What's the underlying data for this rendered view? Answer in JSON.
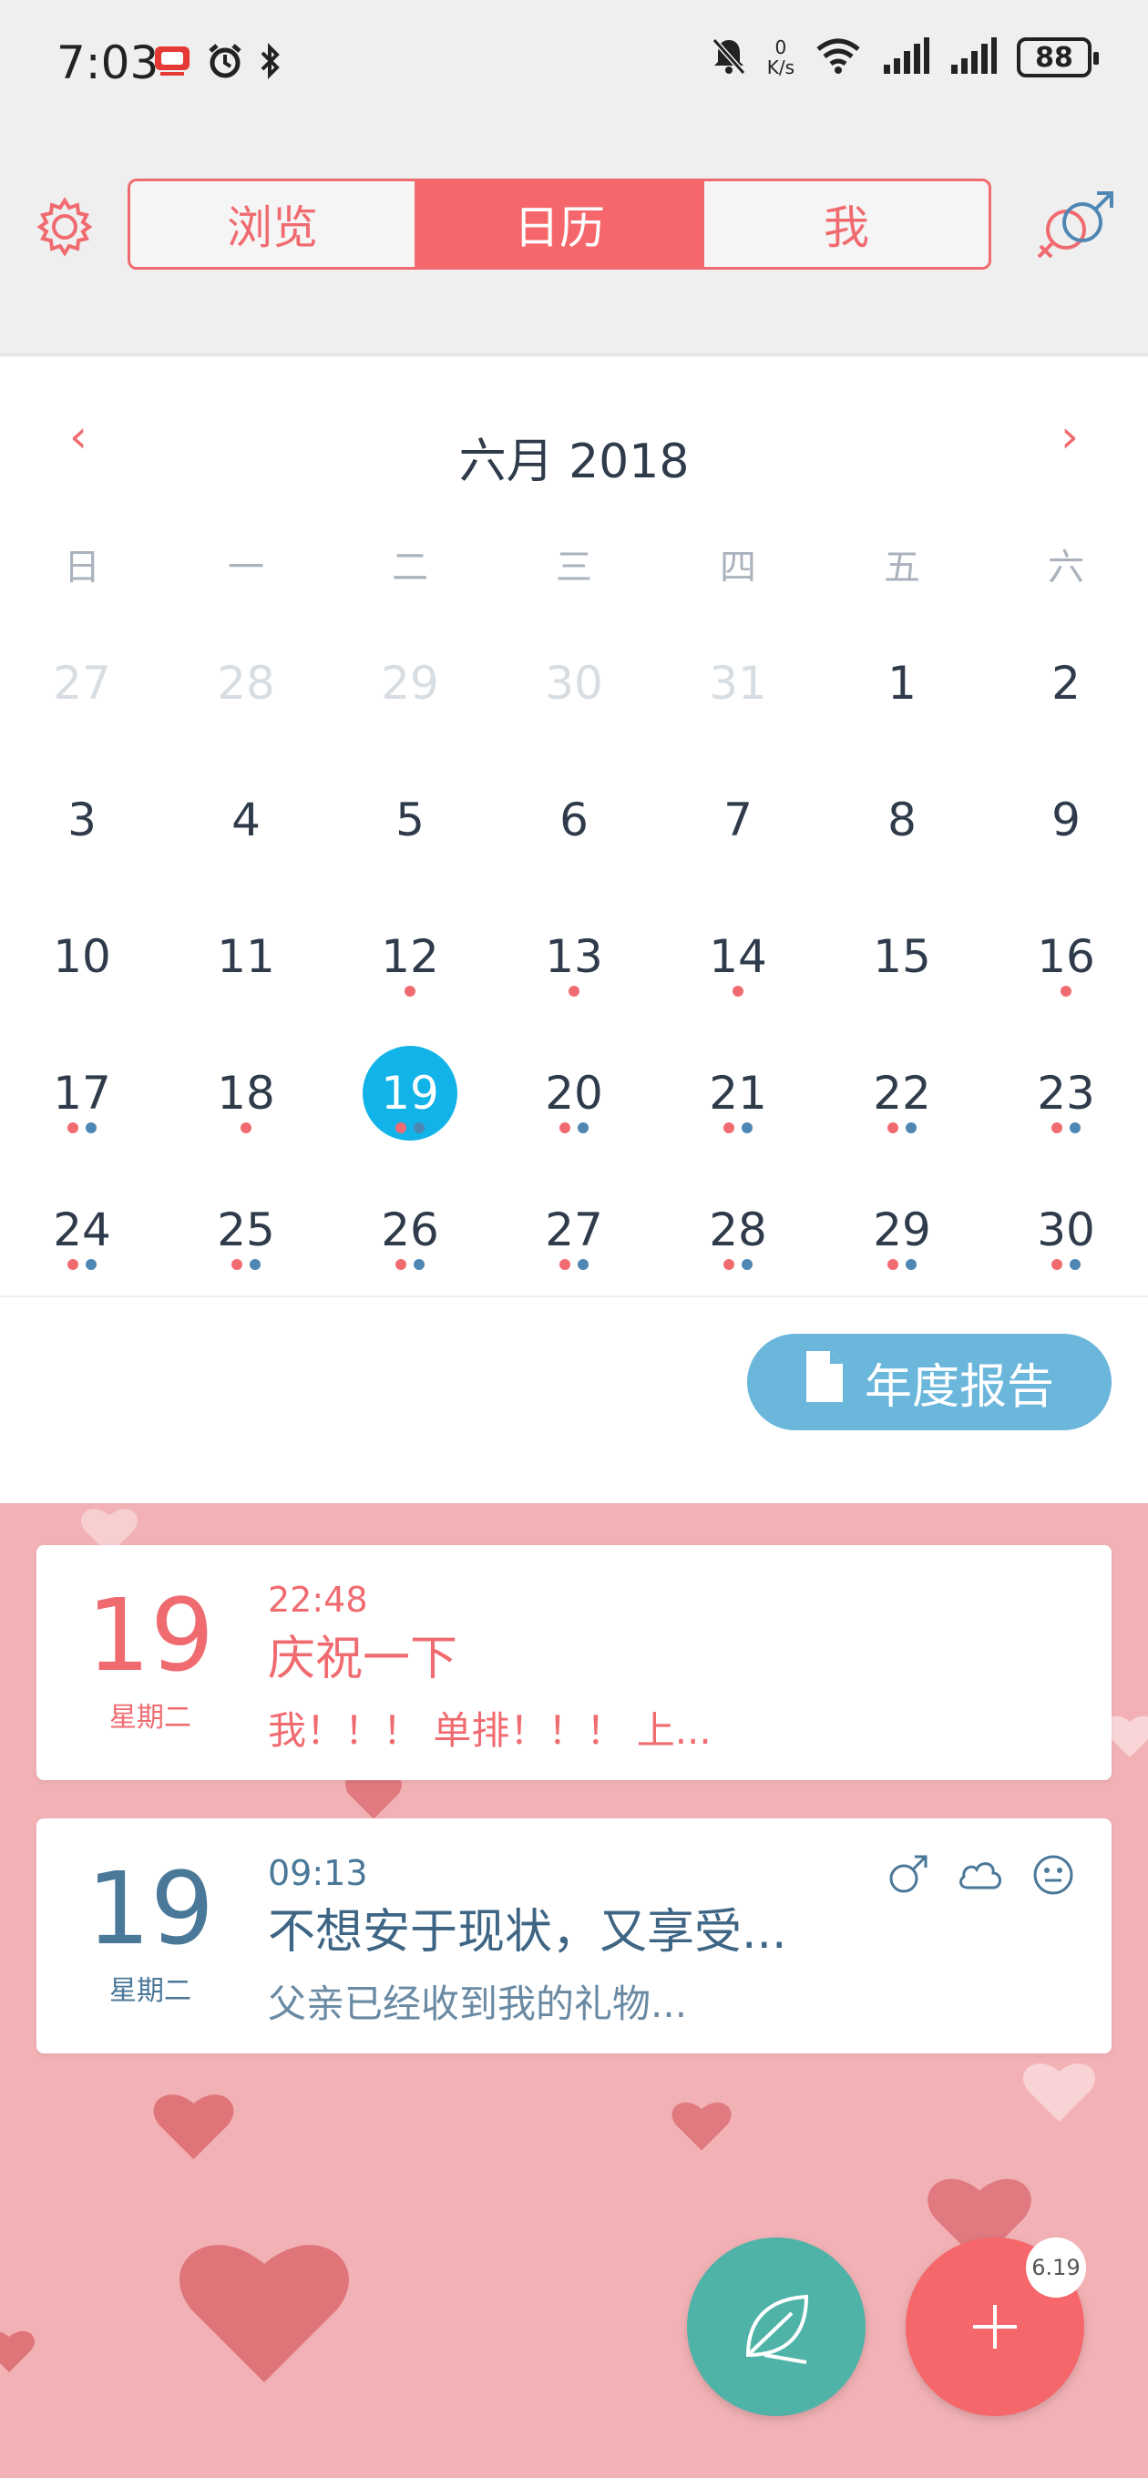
{
  "status_bar": {
    "time": "7:03",
    "net_speed_value": "0",
    "net_speed_unit": "K/s",
    "battery": "88"
  },
  "header": {
    "tabs": [
      {
        "label": "浏览",
        "active": false
      },
      {
        "label": "日历",
        "active": true
      },
      {
        "label": "我",
        "active": false
      }
    ]
  },
  "calendar": {
    "month_title": "六月 2018",
    "prev_label": "‹",
    "next_label": "›",
    "weekdays": [
      "日",
      "一",
      "二",
      "三",
      "四",
      "五",
      "六"
    ],
    "weeks": [
      [
        {
          "d": "27",
          "muted": true
        },
        {
          "d": "28",
          "muted": true
        },
        {
          "d": "29",
          "muted": true
        },
        {
          "d": "30",
          "muted": true
        },
        {
          "d": "31",
          "muted": true
        },
        {
          "d": "1"
        },
        {
          "d": "2"
        }
      ],
      [
        {
          "d": "3"
        },
        {
          "d": "4"
        },
        {
          "d": "5"
        },
        {
          "d": "6"
        },
        {
          "d": "7"
        },
        {
          "d": "8"
        },
        {
          "d": "9"
        }
      ],
      [
        {
          "d": "10"
        },
        {
          "d": "11"
        },
        {
          "d": "12",
          "dots": [
            "red"
          ]
        },
        {
          "d": "13",
          "dots": [
            "red"
          ]
        },
        {
          "d": "14",
          "dots": [
            "red"
          ]
        },
        {
          "d": "15"
        },
        {
          "d": "16",
          "dots": [
            "red"
          ]
        }
      ],
      [
        {
          "d": "17",
          "dots": [
            "red",
            "blue"
          ]
        },
        {
          "d": "18",
          "dots": [
            "red"
          ]
        },
        {
          "d": "19",
          "selected": true,
          "dots": [
            "red",
            "blue"
          ]
        },
        {
          "d": "20",
          "dots": [
            "red",
            "blue"
          ]
        },
        {
          "d": "21",
          "dots": [
            "red",
            "blue"
          ]
        },
        {
          "d": "22",
          "dots": [
            "red",
            "blue"
          ]
        },
        {
          "d": "23",
          "dots": [
            "red",
            "blue"
          ]
        }
      ],
      [
        {
          "d": "24",
          "dots": [
            "red",
            "blue"
          ]
        },
        {
          "d": "25",
          "dots": [
            "red",
            "blue"
          ]
        },
        {
          "d": "26",
          "dots": [
            "red",
            "blue"
          ]
        },
        {
          "d": "27",
          "dots": [
            "red",
            "blue"
          ]
        },
        {
          "d": "28",
          "dots": [
            "red",
            "blue"
          ]
        },
        {
          "d": "29",
          "dots": [
            "red",
            "blue"
          ]
        },
        {
          "d": "30",
          "dots": [
            "red",
            "blue"
          ]
        }
      ]
    ]
  },
  "report_button": {
    "label": "年度报告"
  },
  "entries": [
    {
      "day": "19",
      "weekday": "星期二",
      "time": "22:48",
      "title": "庆祝一下",
      "snippet": "我！！！ 单排！！！ 上...",
      "style": "red"
    },
    {
      "day": "19",
      "weekday": "星期二",
      "time": "09:13",
      "title": "不想安于现状，又享受...",
      "snippet": "父亲已经收到我的礼物...",
      "style": "blue",
      "icons": [
        "male-icon",
        "cloud-icon",
        "smile-icon"
      ]
    }
  ],
  "fab": {
    "badge": "6.19",
    "add_symbol": "+"
  },
  "colors": {
    "accent_red": "#f5676b",
    "selected_blue": "#12b3e8",
    "report_blue": "#6bb7dc",
    "leaf_green": "#4fb3a8",
    "pink_bg": "#f2b2b5"
  }
}
